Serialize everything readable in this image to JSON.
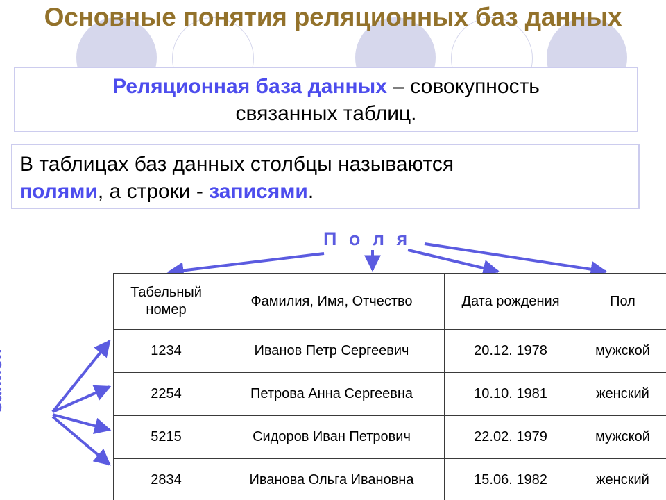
{
  "slide": {
    "title": "Основные понятия реляционных баз данных",
    "title_color": "#93722b",
    "accent_color": "#4d4ded",
    "box_border_color": "#ccccee",
    "decor_circle_color": "#d6d7ec"
  },
  "definition_box": {
    "term": "Реляционная база данных",
    "dash": " – ",
    "rest_line1": "совокупность",
    "line2": "связанных таблиц."
  },
  "explanation_box": {
    "line1": "В таблицах баз данных столбцы называются",
    "line2_a": "полями",
    "line2_b": ", а строки - ",
    "line2_c": "записями",
    "line2_d": "."
  },
  "diagram": {
    "fields_label": "П о л я",
    "records_label": "Записи",
    "arrow_color": "#5b5be0"
  },
  "table": {
    "columns": [
      "Табельный номер",
      "Фамилия, Имя, Отчество",
      "Дата рождения",
      "Пол"
    ],
    "rows": [
      {
        "id": "1234",
        "fio": "Иванов Петр Сергеевич",
        "birth": "20.12. 1978",
        "sex": "мужской"
      },
      {
        "id": "2254",
        "fio": "Петрова Анна Сергеевна",
        "birth": "10.10. 1981",
        "sex": "женский"
      },
      {
        "id": "5215",
        "fio": "Сидоров Иван Петрович",
        "birth": "22.02. 1979",
        "sex": "мужской"
      },
      {
        "id": "2834",
        "fio": "Иванова Ольга Ивановна",
        "birth": "15.06. 1982",
        "sex": "женский"
      }
    ]
  }
}
